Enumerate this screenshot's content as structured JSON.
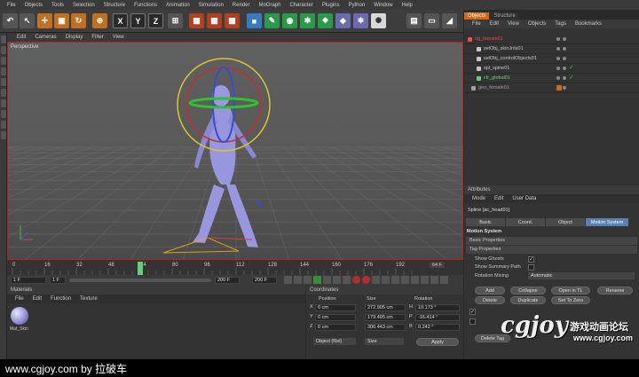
{
  "menu": [
    "File",
    "Objects",
    "Tools",
    "Selection",
    "Structure",
    "Functions",
    "Animation",
    "Simulation",
    "Render",
    "MoGraph",
    "Character",
    "Plugins",
    "Python",
    "Window",
    "Help"
  ],
  "toolbar_axes": [
    "X",
    "Y",
    "Z"
  ],
  "viewport": {
    "menu": [
      "Edit",
      "Cameras",
      "Display",
      "Filter",
      "View"
    ],
    "label": "Perspective"
  },
  "timeline": {
    "ticks": [
      "0",
      "16",
      "32",
      "48",
      "64",
      "80",
      "96",
      "112",
      "128",
      "144",
      "160",
      "176",
      "192"
    ],
    "end_label": "64 F",
    "start_field": "1 F",
    "current_field": "1 F",
    "max_field": "200 F",
    "end_field": "200 F",
    "playhead_frame": 64
  },
  "object_manager": {
    "tabs": [
      "Objects",
      "Structure"
    ],
    "menu": [
      "File",
      "Edit",
      "View",
      "Objects",
      "Tags",
      "Bookmarks"
    ],
    "items": [
      {
        "name": "rig_female01",
        "color": "#e05050"
      },
      {
        "name": "selObj_skinJnts01",
        "color": "#c8c8c8"
      },
      {
        "name": "selObj_controlObjects01",
        "color": "#c8c8c8"
      },
      {
        "name": "spl_spine01",
        "color": "#c8c8c8"
      },
      {
        "name": "ctr_global01",
        "color": "#70d070"
      },
      {
        "name": "geo_female01",
        "color": "#a0a0a0"
      }
    ]
  },
  "attributes": {
    "title": "Attributes",
    "menu": [
      "Mode",
      "Edit",
      "User Data"
    ],
    "object_label": "Spline [ac_head01]",
    "tabs": [
      "Basic",
      "Coord.",
      "Object",
      "Motion System"
    ],
    "section": "Motion System",
    "groups": [
      "Basic Properties",
      "Tag Properties"
    ],
    "show_ghosts": "Show Ghosts",
    "show_summary": "Show Summary Path",
    "rotation_mixing_label": "Rotation Mixing",
    "rotation_mixing_value": "Automatic",
    "buttons": [
      "Add",
      "Collapse",
      "Open in TL",
      "Rename",
      "Delete",
      "Duplicate",
      "Set To Zero"
    ],
    "delete_tag": "Delete Tag"
  },
  "materials": {
    "title": "Materials",
    "menu": [
      "File",
      "Edit",
      "Function",
      "Texture"
    ],
    "item": "Mat_Skin"
  },
  "coordinates": {
    "title": "Coordinates",
    "headers": [
      "Position",
      "Size",
      "Rotation"
    ],
    "rows": [
      {
        "axis": "X",
        "pos": "0 cm",
        "size": "272.905 cm",
        "rot_axis": "H",
        "rot": "10.173 °"
      },
      {
        "axis": "Y",
        "pos": "0 cm",
        "size": "179.405 cm",
        "rot_axis": "P",
        "rot": "-16.414 °"
      },
      {
        "axis": "Z",
        "pos": "0 cm",
        "size": "306.443 cm",
        "rot_axis": "B",
        "rot": "0.242 °"
      }
    ],
    "mode": "Object (Rel)",
    "size_mode": "Size",
    "apply": "Apply"
  },
  "watermark": {
    "text": "www.cgjoy.com by 拉破车",
    "logo_text": "游戏动画论坛",
    "logo_url": "www.cgjoy.com"
  }
}
